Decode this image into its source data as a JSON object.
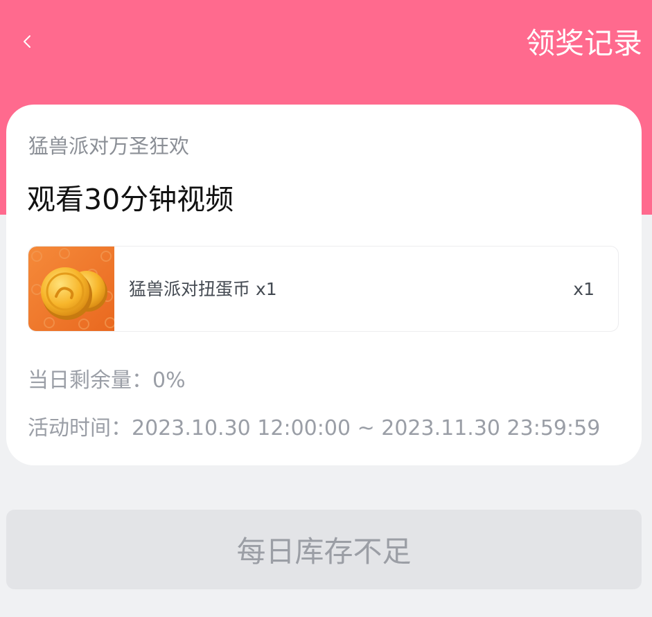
{
  "header": {
    "back_icon": "chevron-left-icon",
    "records_link": "领奖记录",
    "background_color": "#ff6a8e"
  },
  "task": {
    "event_name": "猛兽派对万圣狂欢",
    "title": "观看30分钟视频"
  },
  "reward": {
    "name": "猛兽派对扭蛋币 x1",
    "quantity": "x1",
    "image_icon": "gold-coin-icon"
  },
  "info": {
    "remaining_label": "当日剩余量：",
    "remaining_value": "0%",
    "time_label": "活动时间：",
    "time_value": "2023.10.30 12:00:00 ~ 2023.11.30 23:59:59"
  },
  "action": {
    "button_label": "每日库存不足",
    "disabled": true
  }
}
